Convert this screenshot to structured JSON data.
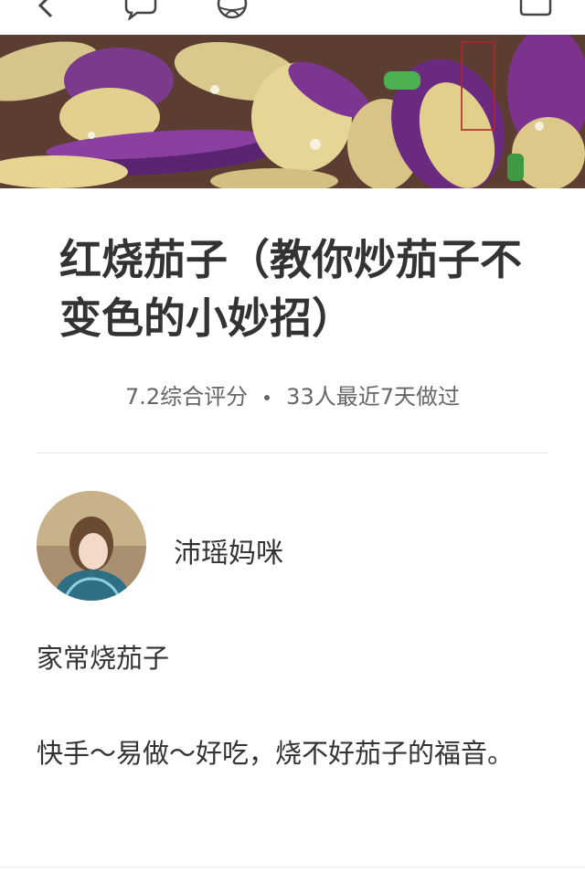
{
  "recipe": {
    "title": "红烧茄子（教你炒茄子不变色的小妙招）",
    "rating_text": "7.2综合评分",
    "recent_cooks_text": "33人最近7天做过"
  },
  "author": {
    "name": "沛瑶妈咪"
  },
  "description": {
    "line1": "家常烧茄子",
    "line2": "快手～易做～好吃，烧不好茄子的福音。"
  },
  "icons": [
    "back-arrow-icon",
    "chat-icon",
    "basketball-icon",
    "bag-icon"
  ],
  "colors": {
    "text": "#333333",
    "secondary": "#666666",
    "divider": "#e6e6e6"
  }
}
